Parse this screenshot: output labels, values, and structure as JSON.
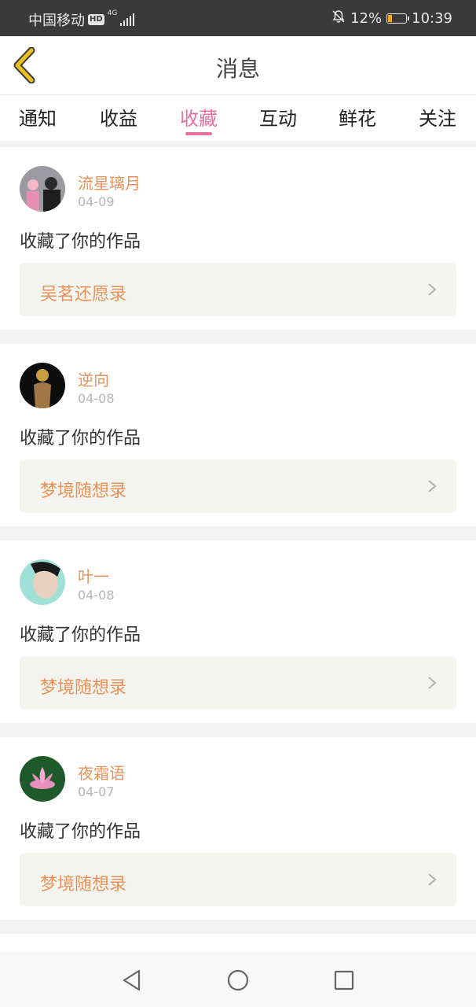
{
  "status_bar": {
    "carrier": "中国移动",
    "hd": "HD",
    "network": "4G",
    "battery_percent": "12%",
    "battery_level": 0.12,
    "time": "10:39"
  },
  "header": {
    "title": "消息"
  },
  "tabs": [
    {
      "label": "通知"
    },
    {
      "label": "收益"
    },
    {
      "label": "收藏",
      "active": true
    },
    {
      "label": "互动"
    },
    {
      "label": "鲜花"
    },
    {
      "label": "关注"
    }
  ],
  "notifications": [
    {
      "user": "流星璃月",
      "date": "04-09",
      "action": "收藏了你的作品",
      "work": "吴茗还愿录"
    },
    {
      "user": "逆向",
      "date": "04-08",
      "action": "收藏了你的作品",
      "work": "梦境随想录"
    },
    {
      "user": "叶一",
      "date": "04-08",
      "action": "收藏了你的作品",
      "work": "梦境随想录"
    },
    {
      "user": "夜霜语",
      "date": "04-07",
      "action": "收藏了你的作品",
      "work": "梦境随想录"
    }
  ],
  "colors": {
    "accent": "#e870a0",
    "name": "#e8925a",
    "back_icon": "#e8c020"
  }
}
